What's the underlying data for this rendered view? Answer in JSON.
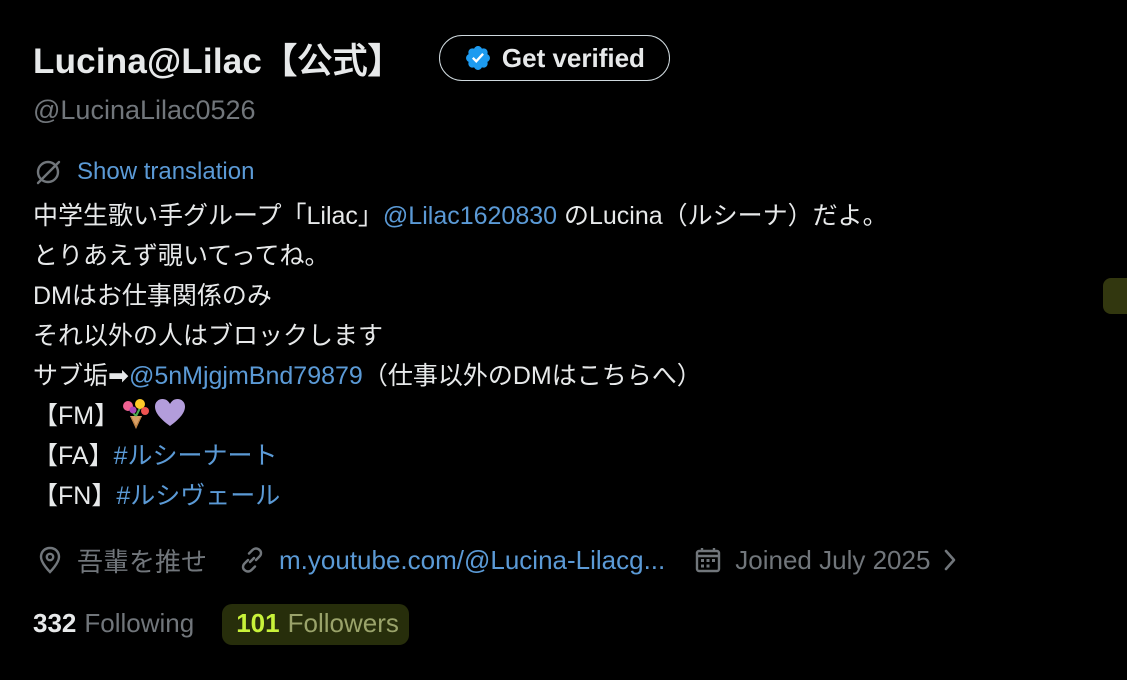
{
  "profile": {
    "display_name": "Lucina@Lilac【公式】",
    "handle": "@LucinaLilac0526",
    "verify_button": "Get verified"
  },
  "translation": {
    "label": "Show translation"
  },
  "bio": {
    "line1_pre": "中学生歌い手グループ「Lilac」",
    "line1_mention": "@Lilac1620830",
    "line1_post": " のLucina（ルシーナ）だよ。",
    "line2": "とりあえず覗いてってね。",
    "line3": "DMはお仕事関係のみ",
    "line4": "それ以外の人はブロックします",
    "line5_pre": "サブ垢➡",
    "line5_mention": "@5nMjgjmBnd79879",
    "line5_post": "（仕事以外のDMはこちらへ）",
    "line6_pre": "【FM】",
    "line7_pre": "【FA】",
    "line7_hashtag": "#ルシーナート",
    "line8_pre": "【FN】",
    "line8_hashtag": "#ルシヴェール"
  },
  "meta": {
    "location": "吾輩を推せ",
    "website": "m.youtube.com/@Lucina-Lilacg...",
    "joined": "Joined July 2025"
  },
  "stats": {
    "following_count": "332",
    "following_label": "Following",
    "followers_count": "101",
    "followers_label": "Followers"
  },
  "colors": {
    "background": "#000000",
    "text": "#e7e9ea",
    "muted": "#71767b",
    "link": "#5b9ad6",
    "verified_badge": "#1d9bf0",
    "highlight": "#c8f23a"
  },
  "icons": {
    "verify": "verified-badge-icon",
    "translate": "translate-icon",
    "location": "location-pin-icon",
    "website": "link-icon",
    "joined": "calendar-icon",
    "emoji_bouquet": "bouquet-emoji",
    "emoji_heart": "purple-heart-emoji"
  }
}
